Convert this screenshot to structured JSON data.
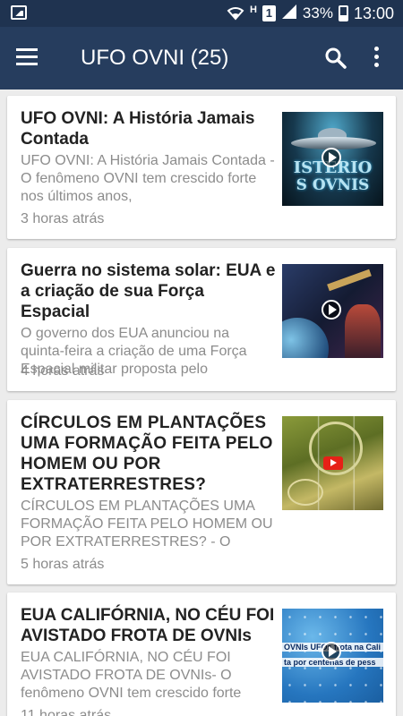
{
  "status_bar": {
    "battery": "33%",
    "sim_slot": "1",
    "network_letter": "H",
    "time": "13:00"
  },
  "app_bar": {
    "title": "UFO OVNI (25)",
    "menu_icon": "hamburger-menu-icon",
    "search_icon": "search-icon",
    "more_icon": "more-vert-icon",
    "background": "#263d5e"
  },
  "articles": [
    {
      "title": "UFO OVNI: A História Jamais Contada",
      "snippet": "UFO OVNI: A História Jamais Contada - O fenômeno OVNI tem crescido forte nos últimos anos,",
      "time": "3 horas atrás",
      "thumb_text": [
        "ISTERIO",
        "S OVNIS"
      ]
    },
    {
      "title": "Guerra no sistema solar: EUA e a criação de sua Força Espacial",
      "snippet": "O governo dos EUA anunciou na quinta-feira a criação de uma Força Espacial militar proposta pelo",
      "time": "4 horas atrás"
    },
    {
      "title": "CÍRCULOS EM PLANTAÇÕES UMA FORMAÇÃO FEITA PELO HOMEM OU POR EXTRATERRESTRES?",
      "snippet": "CÍRCULOS EM PLANTAÇÕES UMA FORMAÇÃO FEITA PELO HOMEM OU POR EXTRATERRESTRES? - O",
      "time": "5 horas atrás"
    },
    {
      "title": "EUA CALIFÓRNIA, NO CÉU FOI AVISTADO FROTA DE OVNIs",
      "snippet": "EUA CALIFÓRNIA, NO CÉU FOI AVISTADO FROTA DE OVNIs- O fenômeno OVNI tem crescido forte",
      "time": "11 horas atrás",
      "thumb_text": [
        "OVNIs UFOs frota na Cali",
        "ta por centenas de pess"
      ]
    }
  ]
}
